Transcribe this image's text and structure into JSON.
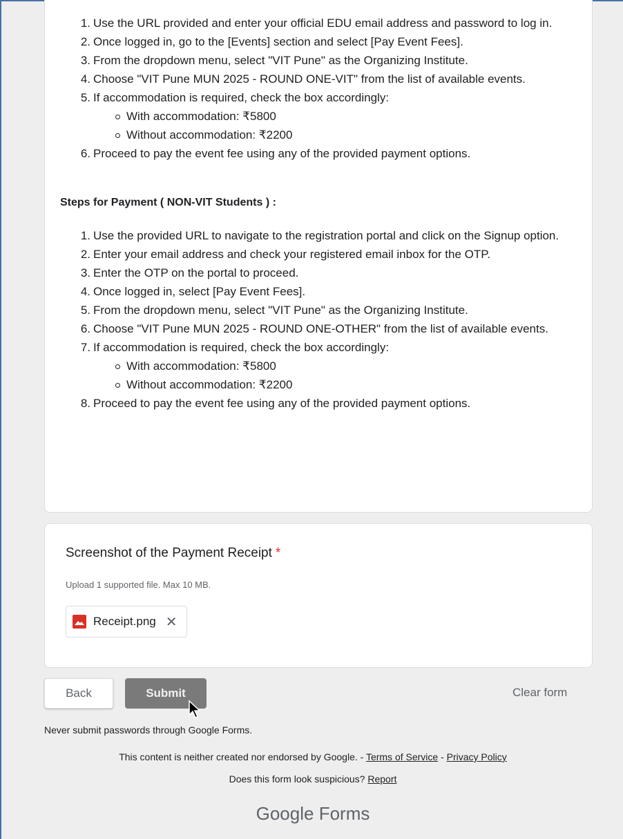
{
  "description": {
    "vit_steps": [
      {
        "num": "1.",
        "text": "Use the URL provided and enter your official EDU email address and password to log in."
      },
      {
        "num": "2.",
        "text": "Once logged in, go to the [Events] section and select [Pay Event Fees]."
      },
      {
        "num": "3.",
        "text": "From the dropdown menu, select \"VIT Pune\" as the Organizing Institute."
      },
      {
        "num": "4.",
        "text": "Choose \"VIT Pune MUN 2025 - ROUND ONE-VIT\" from the list of available events."
      },
      {
        "num": "5.",
        "text": "If accommodation is required, check the box accordingly:",
        "sub": [
          "With accommodation: ₹5800",
          "Without accommodation: ₹2200"
        ]
      },
      {
        "num": "6.",
        "text": "Proceed to pay the event fee using any of the provided payment options."
      }
    ],
    "nonvit_heading": "Steps for Payment ( NON-VIT Students ) :",
    "nonvit_steps": [
      {
        "num": "1.",
        "text": "Use the provided URL to navigate to the registration portal and click on the Signup option."
      },
      {
        "num": "2.",
        "text": "Enter your email address and check your registered email inbox for the OTP."
      },
      {
        "num": "3.",
        "text": "Enter the OTP on the portal to proceed."
      },
      {
        "num": "4.",
        "text": "Once logged in, select [Pay Event Fees]."
      },
      {
        "num": "5.",
        "text": "From the dropdown menu, select \"VIT Pune\" as the Organizing Institute."
      },
      {
        "num": "6.",
        "text": "Choose \"VIT Pune MUN 2025 - ROUND ONE-OTHER\" from the list of available events."
      },
      {
        "num": "7.",
        "text": "If accommodation is required, check the box accordingly:",
        "sub": [
          "With accommodation: ₹5800",
          "Without accommodation: ₹2200"
        ]
      },
      {
        "num": "8.",
        "text": "Proceed to pay the event fee using any of the provided payment options."
      }
    ]
  },
  "upload_question": {
    "title": "Screenshot of the Payment Receipt",
    "required_mark": "*",
    "hint": "Upload 1 supported file. Max 10 MB.",
    "file_name": "Receipt.png",
    "file_icon": "image-file-icon",
    "remove_icon": "close-icon"
  },
  "actions": {
    "back_label": "Back",
    "submit_label": "Submit",
    "clear_label": "Clear form"
  },
  "footer": {
    "password_warning": "Never submit passwords through Google Forms.",
    "disclaimer": "This content is neither created nor endorsed by Google. - ",
    "terms": "Terms of Service",
    "sep": " - ",
    "privacy": "Privacy Policy",
    "suspicious": "Does this form look suspicious? ",
    "report": "Report",
    "brand_google": "Google",
    "brand_forms": " Forms"
  },
  "colors": {
    "accent_required": "#d93025",
    "submit_bg": "#7a7a7a",
    "page_bg": "#eeeeee"
  }
}
